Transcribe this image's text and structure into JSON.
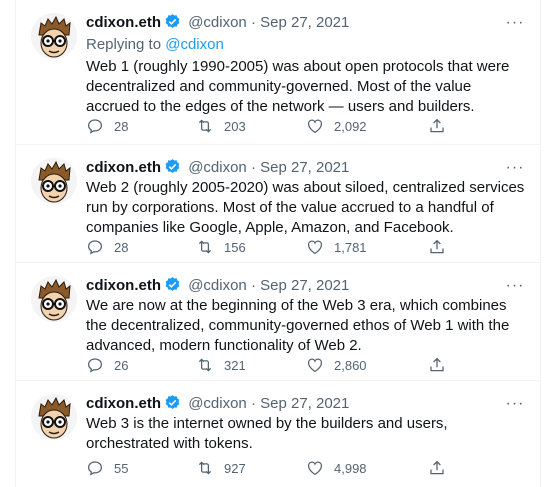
{
  "user": {
    "name": "cdixon.eth",
    "handle": "@cdixon",
    "date": "Sep 27, 2021",
    "separator": "·"
  },
  "replying": {
    "prefix": "Replying to ",
    "target": "@cdixon"
  },
  "tweets": [
    {
      "text": "Web 1 (roughly 1990-2005) was about open protocols that were decentralized and community-governed. Most of the value accrued to the edges of the network — users and builders.",
      "replies": "28",
      "retweets": "203",
      "likes": "2,092"
    },
    {
      "text": "Web 2 (roughly 2005-2020) was about siloed, centralized services run by corporations. Most of the value accrued to a handful of companies like Google, Apple, Amazon, and Facebook.",
      "replies": "28",
      "retweets": "156",
      "likes": "1,781"
    },
    {
      "text": "We are now at the beginning of the Web 3 era, which combines the decentralized, community-governed ethos of Web 1 with the advanced, modern functionality of Web 2.",
      "replies": "26",
      "retweets": "321",
      "likes": "2,860"
    },
    {
      "text": "Web 3 is the internet owned by the builders and users, orchestrated with tokens.",
      "replies": "55",
      "retweets": "927",
      "likes": "4,998"
    }
  ],
  "icons": {
    "more": "more-icon",
    "reply": "reply-icon",
    "retweet": "retweet-icon",
    "like": "heart-icon",
    "share": "share-icon",
    "verified": "verified-badge-icon"
  },
  "colors": {
    "accent": "#1d9bf0",
    "muted": "#536471",
    "text": "#0f1419"
  },
  "more_glyph": "···"
}
